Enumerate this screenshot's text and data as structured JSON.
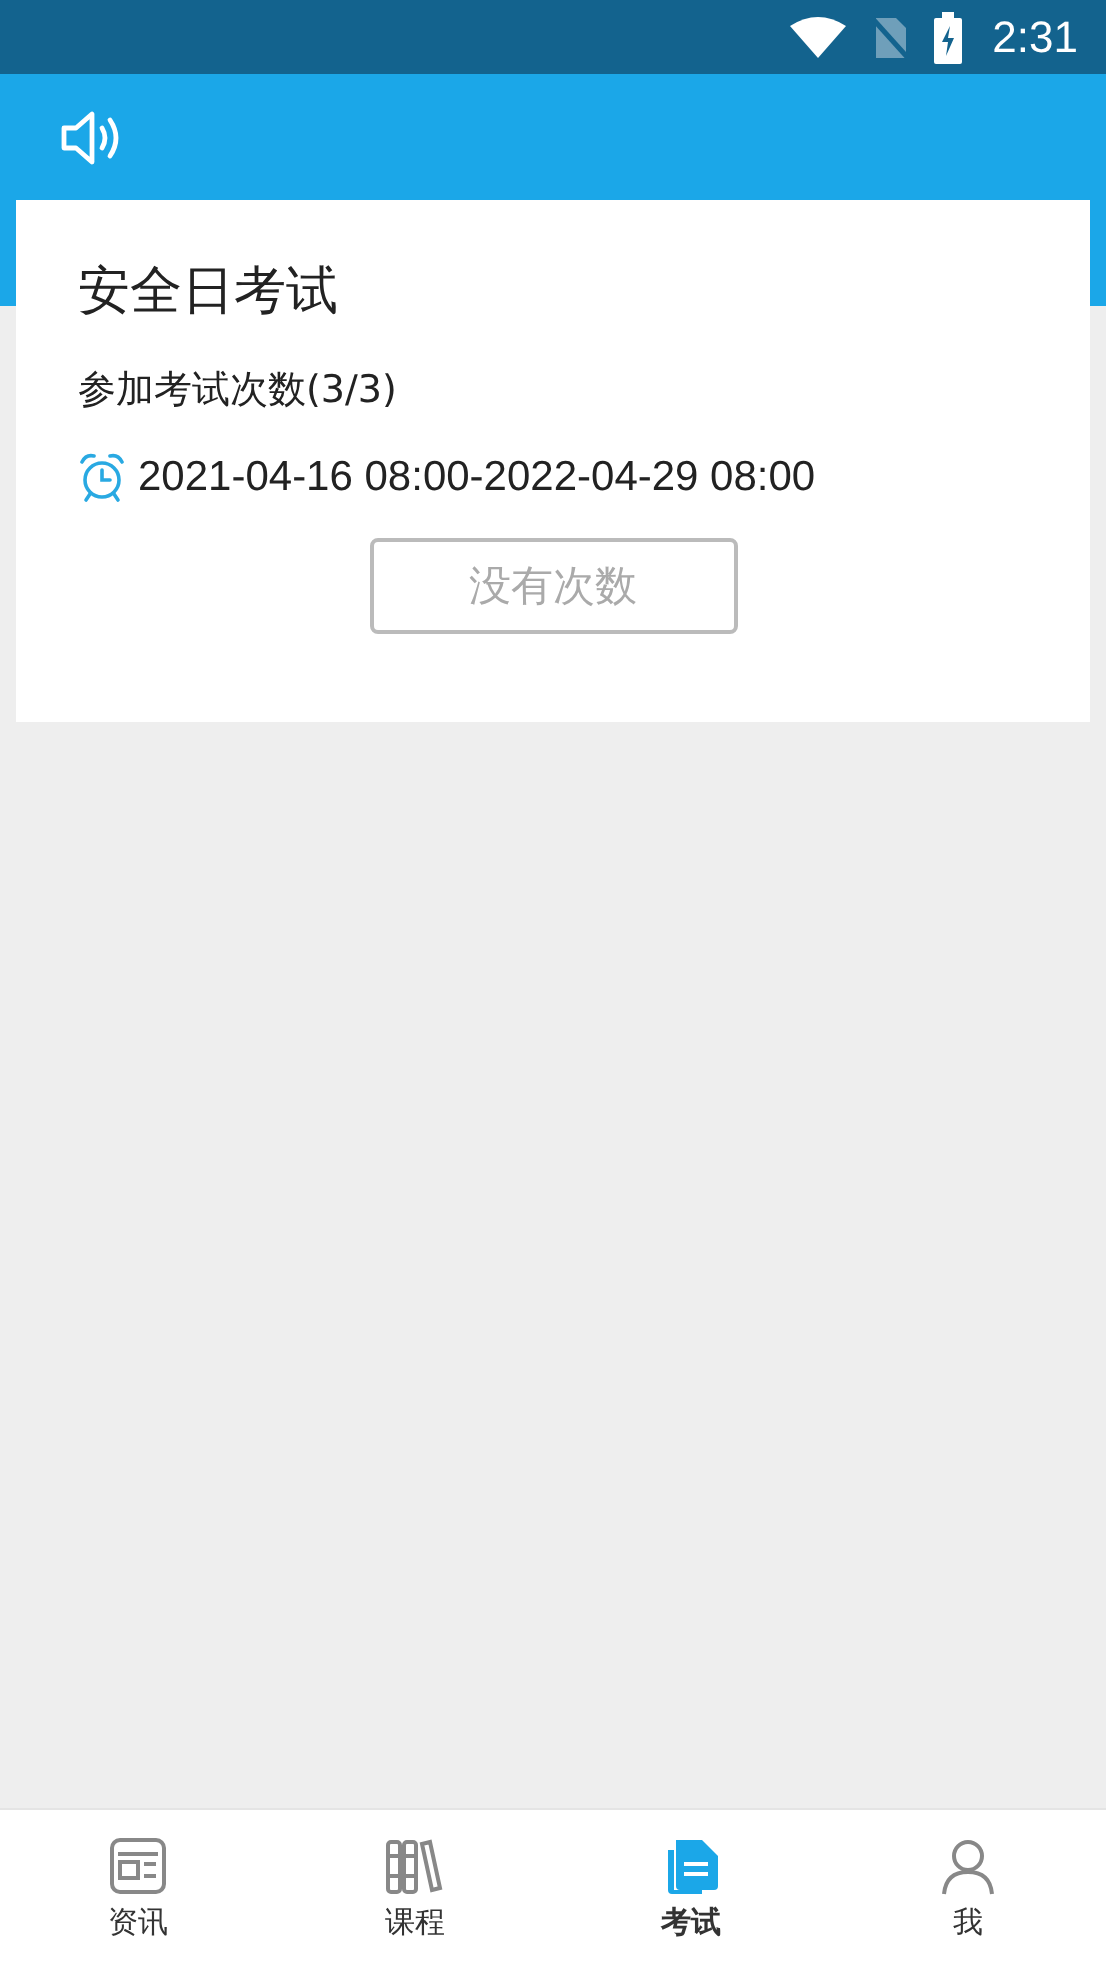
{
  "status_bar": {
    "time": "2:31"
  },
  "exam": {
    "title": "安全日考试",
    "attempts": "参加考试次数(3/3)",
    "period": "2021-04-16 08:00-2022-04-29 08:00",
    "button": {
      "label": "没有次数",
      "disabled": true
    }
  },
  "bottom_nav": [
    {
      "label": "资讯",
      "kind": "news",
      "selected": false
    },
    {
      "label": "课程",
      "kind": "books",
      "selected": false
    },
    {
      "label": "考试",
      "kind": "document",
      "selected": true
    },
    {
      "label": "我",
      "kind": "person",
      "selected": false
    }
  ]
}
